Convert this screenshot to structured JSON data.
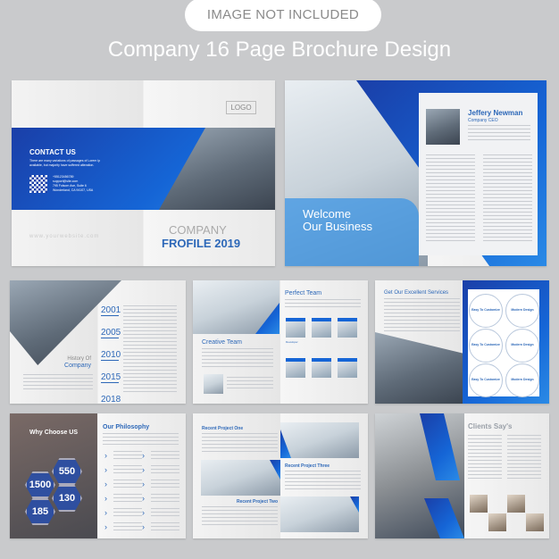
{
  "banner": {
    "label": "IMAGE NOT INCLUDED"
  },
  "title": "Company 16 Page Brochure Design",
  "cover": {
    "contact_title": "CONTACT US",
    "contact_text": "There are many variations of passages of Lorem Ip available, but majority have suffered alteration.",
    "phone": "+55123456789",
    "email": "support@site.com",
    "address1": "795 Folsom Ave, Suite 6",
    "address2": "Wonderland, CA 94107, USA",
    "website": "www.yourwebsite.com",
    "logo": "LOGO",
    "company": "COMPANY",
    "profile": "FROFILE 2019"
  },
  "welcome": {
    "heading1": "Welcome",
    "heading2": "Our Business",
    "name": "Jeffery Newman",
    "role": "Company CEO"
  },
  "history": {
    "title1": "History Of",
    "title2": "Company",
    "years": [
      "2001",
      "2005",
      "2010",
      "2015",
      "2018"
    ]
  },
  "team": {
    "creative": "Creative Team",
    "perfect": "Perfect Team",
    "member_role": "Developer"
  },
  "services": {
    "title": "Get Our Excellent Services",
    "items": [
      "Easy To Customize",
      "Modern Design",
      "Easy To Customize",
      "Modern Design",
      "Easy To Customize",
      "Modern Design"
    ]
  },
  "why": {
    "title": "Why Choose US",
    "stats": [
      "550",
      "1500",
      "130",
      "185"
    ]
  },
  "philosophy": {
    "title": "Our Philosophy"
  },
  "projects": {
    "one": "Recent Project One",
    "two": "Recent Project Two",
    "three": "Recent Project Three"
  },
  "clients": {
    "title": "Clients Say's"
  },
  "colors": {
    "primary_blue": "#1565d6",
    "dark_blue": "#1a3fa8",
    "background": "#c9cacc"
  }
}
